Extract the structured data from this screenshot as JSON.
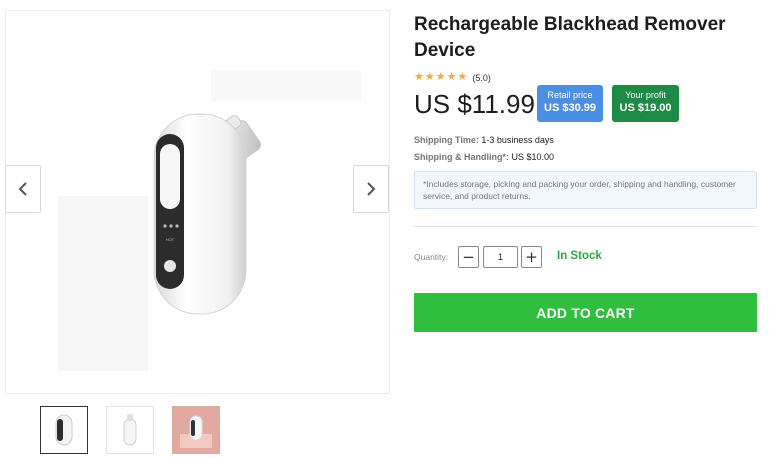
{
  "gallery": {
    "prev_icon": "chevron-left-icon",
    "next_icon": "chevron-right-icon",
    "device_lamp_label": "HOT",
    "thumbnails": [
      "white-device-front",
      "white-device-angle",
      "device-pink-background"
    ]
  },
  "product": {
    "title": "Rechargeable Blackhead Remover Device",
    "rating_stars": 5,
    "rating_text": "(5.0)",
    "price": "US $11.99",
    "retail_label": "Retail price",
    "retail_value": "US $30.99",
    "profit_label": "Your profit",
    "profit_value": "US $19.00"
  },
  "shipping": {
    "time_label": "Shipping Time:",
    "time_value": "1-3 business days",
    "handling_label": "Shipping & Handling*:",
    "handling_value": "US $10.00",
    "note": "*Includes storage, picking and packing your order, shipping and handling, customer service, and product returns."
  },
  "purchase": {
    "quantity_label": "Quantity:",
    "quantity_value": "1",
    "minus": "−",
    "plus": "+",
    "stock": "In Stock",
    "add_to_cart": "ADD TO CART"
  },
  "colors": {
    "retail_badge": "#4a8fe3",
    "profit_badge": "#1d8a45",
    "cart_button": "#2fbe3e",
    "stock_text": "#2ca846",
    "star": "#f3a64d"
  }
}
